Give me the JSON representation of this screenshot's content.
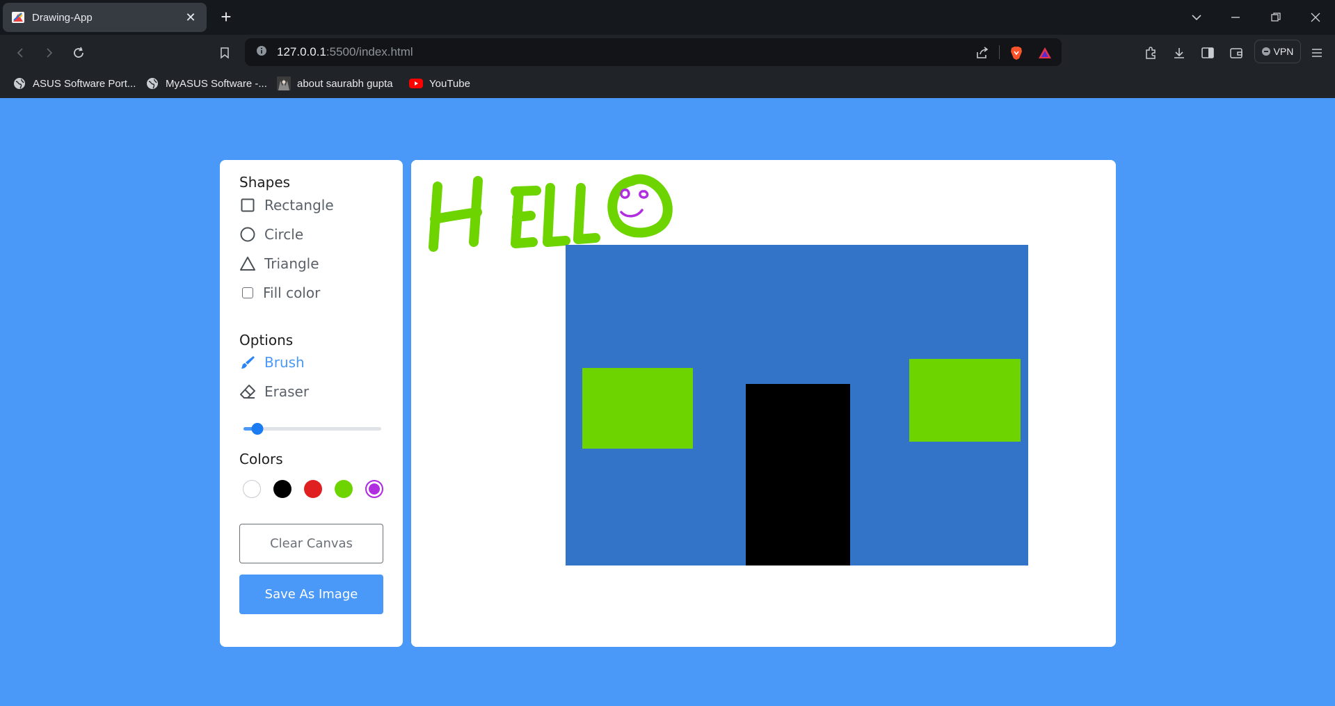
{
  "browser": {
    "tab": {
      "title": "Drawing-App"
    },
    "address": {
      "host": "127.0.0.1",
      "path": ":5500/index.html"
    },
    "vpn_label": "VPN",
    "bookmarks": [
      {
        "label": "ASUS Software Port...",
        "icon": "globe-icon"
      },
      {
        "label": "MyASUS Software -...",
        "icon": "globe-icon"
      },
      {
        "label": "about saurabh gupta",
        "icon": "profile-image-icon"
      },
      {
        "label": "YouTube",
        "icon": "youtube-icon"
      }
    ]
  },
  "tools": {
    "shapes_title": "Shapes",
    "shapes": [
      {
        "label": "Rectangle",
        "icon": "rectangle-icon"
      },
      {
        "label": "Circle",
        "icon": "circle-icon"
      },
      {
        "label": "Triangle",
        "icon": "triangle-icon"
      }
    ],
    "fill_label": "Fill color",
    "fill_checked": false,
    "options_title": "Options",
    "options": [
      {
        "label": "Brush",
        "icon": "brush-icon",
        "active": true
      },
      {
        "label": "Eraser",
        "icon": "eraser-icon",
        "active": false
      }
    ],
    "brush_size_fraction": 0.1,
    "colors_title": "Colors",
    "colors": [
      "#ffffff",
      "#000000",
      "#e02020",
      "#6dd400",
      "#b02edf"
    ],
    "selected_color": "#b02edf",
    "clear_label": "Clear Canvas",
    "save_label": "Save As Image"
  },
  "canvas": {
    "background": "#ffffff",
    "stroke_color_text": "#6dd400",
    "house_color": "#3374c8",
    "window_color": "#6dd400",
    "door_color": "#000000",
    "face_color": "#b02edf"
  }
}
